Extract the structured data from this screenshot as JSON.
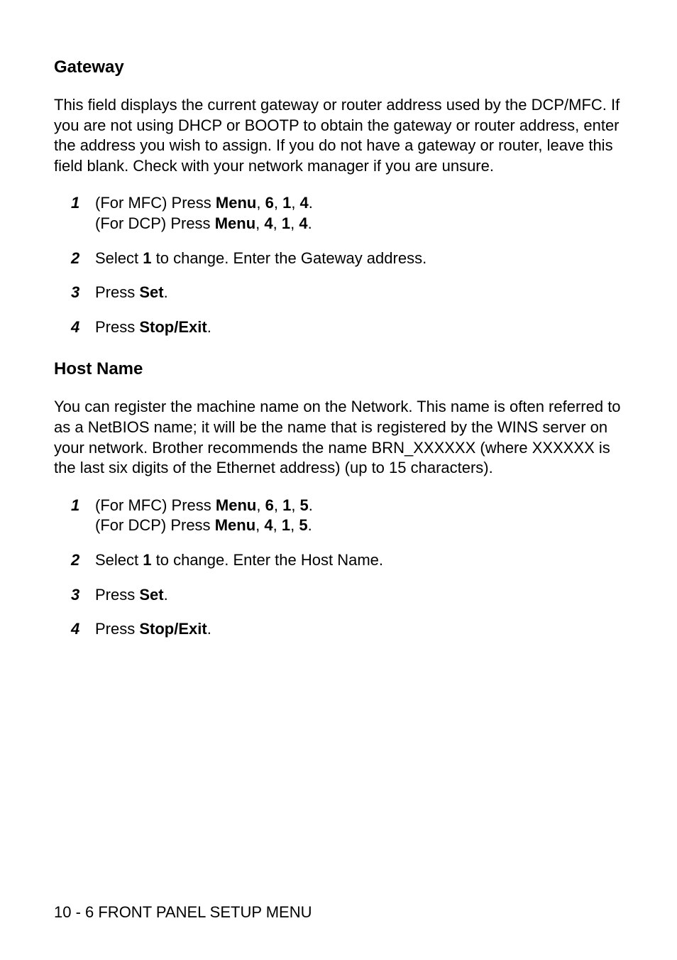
{
  "sections": [
    {
      "heading": "Gateway",
      "paragraph": "This field displays the current gateway or router address used by the DCP/MFC. If you are not using DHCP or BOOTP to obtain the gateway or router address, enter the address you wish to assign. If you do not have a gateway or router, leave this field blank. Check with your network manager if you are unsure.",
      "steps": [
        {
          "num": "1",
          "lines": [
            [
              {
                "t": "(For MFC) Press "
              },
              {
                "t": "Menu",
                "b": true
              },
              {
                "t": ", "
              },
              {
                "t": "6",
                "b": true
              },
              {
                "t": ", "
              },
              {
                "t": "1",
                "b": true
              },
              {
                "t": ", "
              },
              {
                "t": "4",
                "b": true
              },
              {
                "t": "."
              }
            ],
            [
              {
                "t": "(For DCP) Press "
              },
              {
                "t": "Menu",
                "b": true
              },
              {
                "t": ", "
              },
              {
                "t": "4",
                "b": true
              },
              {
                "t": ", "
              },
              {
                "t": "1",
                "b": true
              },
              {
                "t": ", "
              },
              {
                "t": "4",
                "b": true
              },
              {
                "t": "."
              }
            ]
          ]
        },
        {
          "num": "2",
          "lines": [
            [
              {
                "t": "Select "
              },
              {
                "t": "1",
                "b": true
              },
              {
                "t": " to change. Enter the Gateway address."
              }
            ]
          ]
        },
        {
          "num": "3",
          "lines": [
            [
              {
                "t": "Press "
              },
              {
                "t": "Set",
                "b": true
              },
              {
                "t": "."
              }
            ]
          ]
        },
        {
          "num": "4",
          "lines": [
            [
              {
                "t": "Press "
              },
              {
                "t": "Stop/Exit",
                "b": true
              },
              {
                "t": "."
              }
            ]
          ]
        }
      ]
    },
    {
      "heading": "Host Name",
      "paragraph": "You can register the machine name on the Network. This name is often referred to as a NetBIOS name; it will be the name that is registered by the WINS server on your network. Brother recommends the name BRN_XXXXXX (where XXXXXX is the last six digits of the Ethernet address) (up to 15 characters).",
      "steps": [
        {
          "num": "1",
          "lines": [
            [
              {
                "t": "(For MFC) Press "
              },
              {
                "t": "Menu",
                "b": true
              },
              {
                "t": ", "
              },
              {
                "t": "6",
                "b": true
              },
              {
                "t": ", "
              },
              {
                "t": "1",
                "b": true
              },
              {
                "t": ", "
              },
              {
                "t": "5",
                "b": true
              },
              {
                "t": "."
              }
            ],
            [
              {
                "t": "(For DCP) Press "
              },
              {
                "t": "Menu",
                "b": true
              },
              {
                "t": ", "
              },
              {
                "t": "4",
                "b": true
              },
              {
                "t": ", "
              },
              {
                "t": "1",
                "b": true
              },
              {
                "t": ", "
              },
              {
                "t": "5",
                "b": true
              },
              {
                "t": "."
              }
            ]
          ]
        },
        {
          "num": "2",
          "lines": [
            [
              {
                "t": "Select "
              },
              {
                "t": "1",
                "b": true
              },
              {
                "t": " to change. Enter the Host Name."
              }
            ]
          ]
        },
        {
          "num": "3",
          "lines": [
            [
              {
                "t": "Press "
              },
              {
                "t": "Set",
                "b": true
              },
              {
                "t": "."
              }
            ]
          ]
        },
        {
          "num": "4",
          "lines": [
            [
              {
                "t": "Press "
              },
              {
                "t": "Stop/Exit",
                "b": true
              },
              {
                "t": "."
              }
            ]
          ]
        }
      ]
    }
  ],
  "footer": "10 - 6 FRONT PANEL SETUP MENU"
}
